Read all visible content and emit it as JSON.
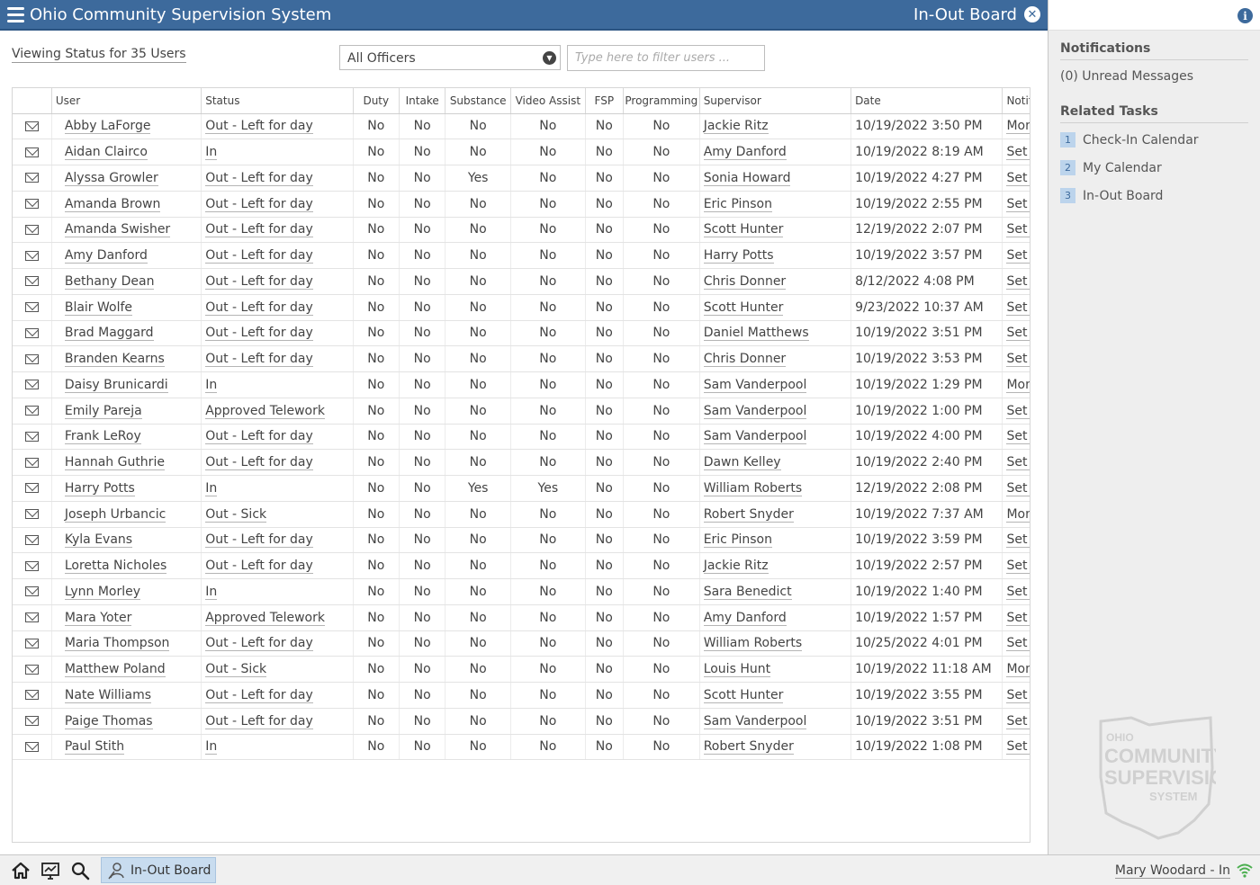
{
  "header": {
    "app_title": "Ohio Community Supervision System",
    "page_title": "In-Out Board"
  },
  "toolbar": {
    "viewing_text": "Viewing Status for 35 Users",
    "officer_select_value": "All Officers",
    "filter_placeholder": "Type here to filter users ..."
  },
  "table": {
    "columns": {
      "user": "User",
      "status": "Status",
      "duty": "Duty",
      "intake": "Intake",
      "substance": "Substance",
      "video_assist": "Video Assist",
      "fsp": "FSP",
      "programming": "Programming",
      "supervisor": "Supervisor",
      "date": "Date",
      "notification": "Notific"
    },
    "rows": [
      {
        "user": "Abby LaForge",
        "status": "Out - Left for day",
        "duty": "No",
        "intake": "No",
        "substance": "No",
        "video_assist": "No",
        "fsp": "No",
        "programming": "No",
        "supervisor": "Jackie Ritz",
        "date": "10/19/2022 3:50 PM",
        "notification": "Moni"
      },
      {
        "user": "Aidan Clairco",
        "status": "In",
        "duty": "No",
        "intake": "No",
        "substance": "No",
        "video_assist": "No",
        "fsp": "No",
        "programming": "No",
        "supervisor": "Amy Danford",
        "date": "10/19/2022 8:19 AM",
        "notification": "Set N"
      },
      {
        "user": "Alyssa Growler",
        "status": "Out - Left for day",
        "duty": "No",
        "intake": "No",
        "substance": "Yes",
        "video_assist": "No",
        "fsp": "No",
        "programming": "No",
        "supervisor": "Sonia Howard",
        "date": "10/19/2022 4:27 PM",
        "notification": "Set N"
      },
      {
        "user": "Amanda Brown",
        "status": "Out - Left for day",
        "duty": "No",
        "intake": "No",
        "substance": "No",
        "video_assist": "No",
        "fsp": "No",
        "programming": "No",
        "supervisor": "Eric Pinson",
        "date": "10/19/2022 2:55 PM",
        "notification": "Set N"
      },
      {
        "user": "Amanda Swisher",
        "status": "Out - Left for day",
        "duty": "No",
        "intake": "No",
        "substance": "No",
        "video_assist": "No",
        "fsp": "No",
        "programming": "No",
        "supervisor": "Scott Hunter",
        "date": "12/19/2022 2:07 PM",
        "notification": "Set N"
      },
      {
        "user": "Amy Danford",
        "status": "Out - Left for day",
        "duty": "No",
        "intake": "No",
        "substance": "No",
        "video_assist": "No",
        "fsp": "No",
        "programming": "No",
        "supervisor": "Harry Potts",
        "date": "10/19/2022 3:57 PM",
        "notification": "Set N"
      },
      {
        "user": "Bethany Dean",
        "status": "Out - Left for day",
        "duty": "No",
        "intake": "No",
        "substance": "No",
        "video_assist": "No",
        "fsp": "No",
        "programming": "No",
        "supervisor": "Chris Donner",
        "date": "8/12/2022 4:08 PM",
        "notification": "Set N"
      },
      {
        "user": "Blair Wolfe",
        "status": "Out - Left for day",
        "duty": "No",
        "intake": "No",
        "substance": "No",
        "video_assist": "No",
        "fsp": "No",
        "programming": "No",
        "supervisor": "Scott Hunter",
        "date": "9/23/2022 10:37 AM",
        "notification": "Set N"
      },
      {
        "user": "Brad Maggard",
        "status": "Out - Left for day",
        "duty": "No",
        "intake": "No",
        "substance": "No",
        "video_assist": "No",
        "fsp": "No",
        "programming": "No",
        "supervisor": "Daniel Matthews",
        "date": "10/19/2022 3:51 PM",
        "notification": "Set N"
      },
      {
        "user": "Branden Kearns",
        "status": "Out - Left for day",
        "duty": "No",
        "intake": "No",
        "substance": "No",
        "video_assist": "No",
        "fsp": "No",
        "programming": "No",
        "supervisor": "Chris Donner",
        "date": "10/19/2022 3:53 PM",
        "notification": "Set N"
      },
      {
        "user": "Daisy Brunicardi",
        "status": "In",
        "duty": "No",
        "intake": "No",
        "substance": "No",
        "video_assist": "No",
        "fsp": "No",
        "programming": "No",
        "supervisor": "Sam Vanderpool",
        "date": "10/19/2022 1:29 PM",
        "notification": "Moni"
      },
      {
        "user": "Emily Pareja",
        "status": "Approved Telework",
        "duty": "No",
        "intake": "No",
        "substance": "No",
        "video_assist": "No",
        "fsp": "No",
        "programming": "No",
        "supervisor": "Sam Vanderpool",
        "date": "10/19/2022 1:00 PM",
        "notification": "Set N"
      },
      {
        "user": "Frank LeRoy",
        "status": "Out - Left for day",
        "duty": "No",
        "intake": "No",
        "substance": "No",
        "video_assist": "No",
        "fsp": "No",
        "programming": "No",
        "supervisor": "Sam Vanderpool",
        "date": "10/19/2022 4:00 PM",
        "notification": "Set N"
      },
      {
        "user": "Hannah Guthrie",
        "status": "Out - Left for day",
        "duty": "No",
        "intake": "No",
        "substance": "No",
        "video_assist": "No",
        "fsp": "No",
        "programming": "No",
        "supervisor": "Dawn Kelley",
        "date": "10/19/2022 2:40 PM",
        "notification": "Set N"
      },
      {
        "user": "Harry Potts",
        "status": "In",
        "duty": "No",
        "intake": "No",
        "substance": "Yes",
        "video_assist": "Yes",
        "fsp": "No",
        "programming": "No",
        "supervisor": "William Roberts",
        "date": "12/19/2022 2:08 PM",
        "notification": "Set N"
      },
      {
        "user": "Joseph Urbancic",
        "status": "Out - Sick",
        "duty": "No",
        "intake": "No",
        "substance": "No",
        "video_assist": "No",
        "fsp": "No",
        "programming": "No",
        "supervisor": "Robert Snyder",
        "date": "10/19/2022 7:37 AM",
        "notification": "Moni"
      },
      {
        "user": "Kyla Evans",
        "status": "Out - Left for day",
        "duty": "No",
        "intake": "No",
        "substance": "No",
        "video_assist": "No",
        "fsp": "No",
        "programming": "No",
        "supervisor": "Eric Pinson",
        "date": "10/19/2022 3:59 PM",
        "notification": "Set N"
      },
      {
        "user": "Loretta Nicholes",
        "status": "Out - Left for day",
        "duty": "No",
        "intake": "No",
        "substance": "No",
        "video_assist": "No",
        "fsp": "No",
        "programming": "No",
        "supervisor": "Jackie Ritz",
        "date": "10/19/2022 2:57 PM",
        "notification": "Set N"
      },
      {
        "user": "Lynn Morley",
        "status": "In",
        "duty": "No",
        "intake": "No",
        "substance": "No",
        "video_assist": "No",
        "fsp": "No",
        "programming": "No",
        "supervisor": "Sara Benedict",
        "date": "10/19/2022 1:40 PM",
        "notification": "Set N"
      },
      {
        "user": "Mara Yoter",
        "status": "Approved Telework",
        "duty": "No",
        "intake": "No",
        "substance": "No",
        "video_assist": "No",
        "fsp": "No",
        "programming": "No",
        "supervisor": "Amy Danford",
        "date": "10/19/2022 1:57 PM",
        "notification": "Set N"
      },
      {
        "user": "Maria Thompson",
        "status": "Out - Left for day",
        "duty": "No",
        "intake": "No",
        "substance": "No",
        "video_assist": "No",
        "fsp": "No",
        "programming": "No",
        "supervisor": "William Roberts",
        "date": "10/25/2022 4:01 PM",
        "notification": "Set N"
      },
      {
        "user": "Matthew Poland",
        "status": "Out - Sick",
        "duty": "No",
        "intake": "No",
        "substance": "No",
        "video_assist": "No",
        "fsp": "No",
        "programming": "No",
        "supervisor": "Louis Hunt",
        "date": "10/19/2022 11:18 AM",
        "notification": "Moni"
      },
      {
        "user": "Nate Williams",
        "status": "Out - Left for day",
        "duty": "No",
        "intake": "No",
        "substance": "No",
        "video_assist": "No",
        "fsp": "No",
        "programming": "No",
        "supervisor": "Scott Hunter",
        "date": "10/19/2022 3:55 PM",
        "notification": "Set N"
      },
      {
        "user": "Paige Thomas",
        "status": "Out - Left for day",
        "duty": "No",
        "intake": "No",
        "substance": "No",
        "video_assist": "No",
        "fsp": "No",
        "programming": "No",
        "supervisor": "Sam Vanderpool",
        "date": "10/19/2022 3:51 PM",
        "notification": "Set N"
      },
      {
        "user": "Paul Stith",
        "status": "In",
        "duty": "No",
        "intake": "No",
        "substance": "No",
        "video_assist": "No",
        "fsp": "No",
        "programming": "No",
        "supervisor": "Robert Snyder",
        "date": "10/19/2022 1:08 PM",
        "notification": "Set N"
      }
    ]
  },
  "sidebar": {
    "notifications_heading": "Notifications",
    "unread_messages": "(0) Unread Messages",
    "related_tasks_heading": "Related Tasks",
    "tasks": [
      {
        "number": "1",
        "label": "Check-In Calendar"
      },
      {
        "number": "2",
        "label": "My Calendar"
      },
      {
        "number": "3",
        "label": "In-Out Board"
      }
    ],
    "watermark": "OHIO COMMUNITY SUPERVISION SYSTEM"
  },
  "bottombar": {
    "active_tab": "In-Out Board",
    "user_status": "Mary Woodard - In",
    "icons": [
      "home-icon",
      "dashboard-icon",
      "search-icon",
      "officer-icon",
      "wifi-icon"
    ]
  },
  "colors": {
    "header_blue": "#3d6a9c",
    "sidebar_bg": "#eeeeee",
    "active_tab": "#c8dcef",
    "status_green": "#4caf50"
  }
}
